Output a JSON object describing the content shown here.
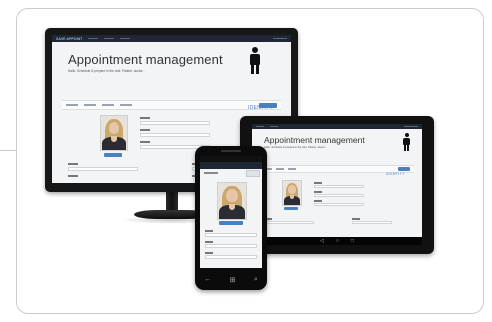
{
  "monitor": {
    "brand": "SAVE APPOINT",
    "title": "Appointment management",
    "subtitle": "Hallo, Schedule & prepare in the visit. Patient, doctor...",
    "identity_label": "IDENTITY"
  },
  "tablet": {
    "title": "Appointment management",
    "subtitle": "Hallo, Schedule & prepare in the visit. Patient, doctor...",
    "identity_label": "IDENTITY",
    "sysbar": {
      "back": "◁",
      "home": "○",
      "recent": "□"
    }
  },
  "phone": {
    "keys": {
      "back": "←",
      "home": "⊞",
      "search": "⌕"
    }
  },
  "colors": {
    "accent": "#4a7fc0",
    "appbar": "#1e2733",
    "frame": "#c9ccce"
  },
  "icons": [
    "person-icon",
    "back-icon",
    "home-icon",
    "search-icon"
  ]
}
